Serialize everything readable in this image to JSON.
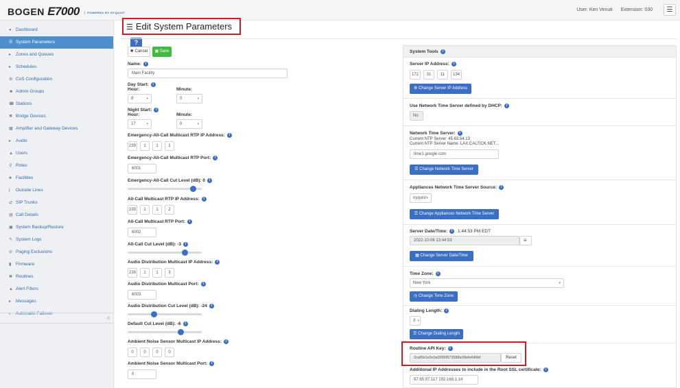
{
  "header": {
    "brand": "BOGEN",
    "product": "E7000",
    "tagline": "POWERED BY NYQUIST",
    "user": "User: Ken Venuti",
    "extension": "Extension: 030",
    "menu_icon": "hamburger-icon"
  },
  "sidebar": {
    "items": [
      {
        "label": "Dashboard",
        "icon": "dashboard-icon"
      },
      {
        "label": "System Parameters",
        "icon": "list-icon"
      },
      {
        "label": "Zones and Queues",
        "icon": "zones-icon"
      },
      {
        "label": "Schedules",
        "icon": "calendar-icon"
      },
      {
        "label": "CoS Configuration",
        "icon": "cog-icon"
      },
      {
        "label": "Admin Groups",
        "icon": "group-icon"
      },
      {
        "label": "Stations",
        "icon": "phone-icon"
      },
      {
        "label": "Bridge Devices",
        "icon": "bridge-icon"
      },
      {
        "label": "Amplifier and Gateway Devices",
        "icon": "amplifier-icon"
      },
      {
        "label": "Audio",
        "icon": "audio-icon"
      },
      {
        "label": "Users",
        "icon": "user-icon"
      },
      {
        "label": "Roles",
        "icon": "roles-icon"
      },
      {
        "label": "Facilities",
        "icon": "facilities-icon"
      },
      {
        "label": "Outside Lines",
        "icon": "outside-line-icon"
      },
      {
        "label": "SIP Trunks",
        "icon": "trunk-icon"
      },
      {
        "label": "Call Details",
        "icon": "details-icon"
      },
      {
        "label": "System Backup/Restore",
        "icon": "backup-icon"
      },
      {
        "label": "System Logs",
        "icon": "logs-icon"
      },
      {
        "label": "Paging Exclusions",
        "icon": "exclusion-icon"
      },
      {
        "label": "Firmware",
        "icon": "firmware-icon"
      },
      {
        "label": "Routines",
        "icon": "routines-icon"
      },
      {
        "label": "Alert Filters",
        "icon": "alert-icon"
      },
      {
        "label": "Messages",
        "icon": "messages-icon"
      },
      {
        "label": "Automatic Failover",
        "icon": "failover-icon"
      }
    ],
    "active": "System Parameters",
    "collapse_glyph": "«"
  },
  "page": {
    "title": "Edit System Parameters",
    "help": "?"
  },
  "form": {
    "cancel_label": "Cancel",
    "save_label": "Save",
    "name_label": "Name:",
    "name_value": "Main Facility",
    "day_start_label": "Day Start:",
    "night_start_label": "Night Start:",
    "hour_label": "Hour:",
    "minute_label": "Minute:",
    "day_hour": "8",
    "day_minute": "0",
    "night_hour": "17",
    "night_minute": "0",
    "eac_ip_label": "Emergency-All-Call Multicast RTP IP Address:",
    "eac_ip": [
      "239",
      "1",
      "1",
      "1"
    ],
    "eac_port_label": "Emergency-All-Call Multicast RTP Port:",
    "eac_port": "6001",
    "eac_level_label": "Emergency-All-Call Cut Level (dB): 0",
    "eac_level_pct": 0.92,
    "ac_ip_label": "All-Call Multicast RTP IP Address:",
    "ac_ip": [
      "239",
      "1",
      "1",
      "2"
    ],
    "ac_port_label": "All-Call Multicast RTP Port:",
    "ac_port": "6002",
    "ac_level_label": "All-Call Cut Level (dB): -3",
    "ac_level_pct": 0.8,
    "ad_ip_label": "Audio Distribution Multicast IP Address:",
    "ad_ip": [
      "239",
      "1",
      "1",
      "3"
    ],
    "ad_port_label": "Audio Distribution Multicast Port:",
    "ad_port": "6003",
    "ad_level_label": "Audio Distribution Cut Level (dB): -24",
    "ad_level_pct": 0.34,
    "def_level_label": "Default Cut Level (dB): -6",
    "def_level_pct": 0.74,
    "ans_ip_label": "Ambient Noise Sensor Multicast IP Address:",
    "ans_ip": [
      "0",
      "0",
      "0",
      "0"
    ],
    "ans_port_label": "Ambient Noise Sensor Multicast Port:",
    "ans_port": "0"
  },
  "tools": {
    "title": "System Tools",
    "server_ip_label": "Server IP Address:",
    "server_ip": [
      "172",
      "31",
      "11",
      "134"
    ],
    "change_ip_btn": "Change Server IP Address",
    "ntp_dhcp_label": "Use Network Time Server defined by DHCP:",
    "ntp_dhcp_value": "No",
    "ntp_label": "Network Time Server:",
    "ntp_current": "Current NTP Server: 45.63.54.13",
    "ntp_current_name": "Current NTP Server Name: LAX.CALTICK.NET...",
    "ntp_value": "time1.google.com",
    "change_ntp_btn": "Change Network Time Server",
    "app_ntp_label": "Appliances Network Time Server Source:",
    "app_ntp_value": "nyquist",
    "change_app_ntp_btn": "Change Appliances Network Time Server",
    "datetime_label": "Server Date/Time:",
    "datetime_now": "1:44:53 PM EDT",
    "datetime_value": "2022-10-06 13:44:53",
    "change_dt_btn": "Change Server Date/Time",
    "tz_label": "Time Zone:",
    "tz_value": "New York",
    "change_tz_btn": "Change Time Zone",
    "dial_label": "Dialing Length:",
    "dial_value": "3",
    "change_dial_btn": "Change Dialing Length",
    "api_label": "Routine API Key:",
    "api_value": "2caf5b1e0c0a0995f573588e09efe648bf",
    "reset_label": "Reset",
    "ssl_label": "Additional IP Addresses to include in the Root SSL certificate:",
    "ssl_value": "97.65.97.117 192.168.1.14"
  }
}
